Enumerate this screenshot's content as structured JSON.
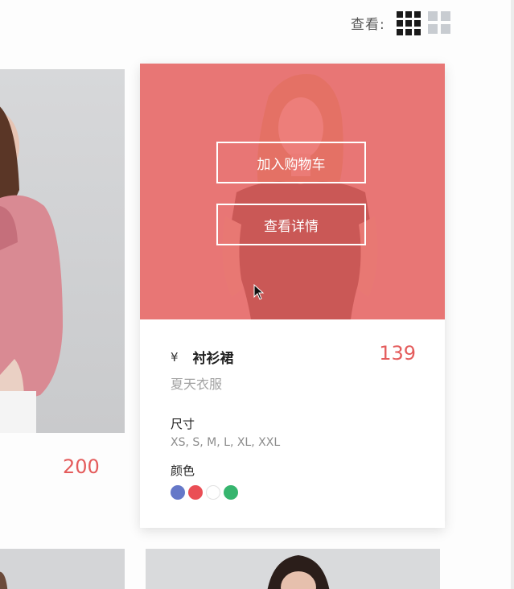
{
  "view": {
    "label": "查看:"
  },
  "left_product": {
    "price": "200"
  },
  "card": {
    "add_to_cart": "加入购物车",
    "view_details": "查看详情",
    "currency": "¥",
    "name": "衬衫裙",
    "price": "139",
    "subtitle": "夏天衣服",
    "size_label": "尺寸",
    "sizes": "XS, S, M, L, XL, XXL",
    "color_label": "颜色",
    "colors": [
      "#6578c8",
      "#ea4e55",
      "#ffffff",
      "#36b56e"
    ]
  },
  "icons": {
    "view_dense": "grid-9-icon",
    "view_large": "grid-4-icon",
    "cursor": "mouse-cursor-icon"
  }
}
